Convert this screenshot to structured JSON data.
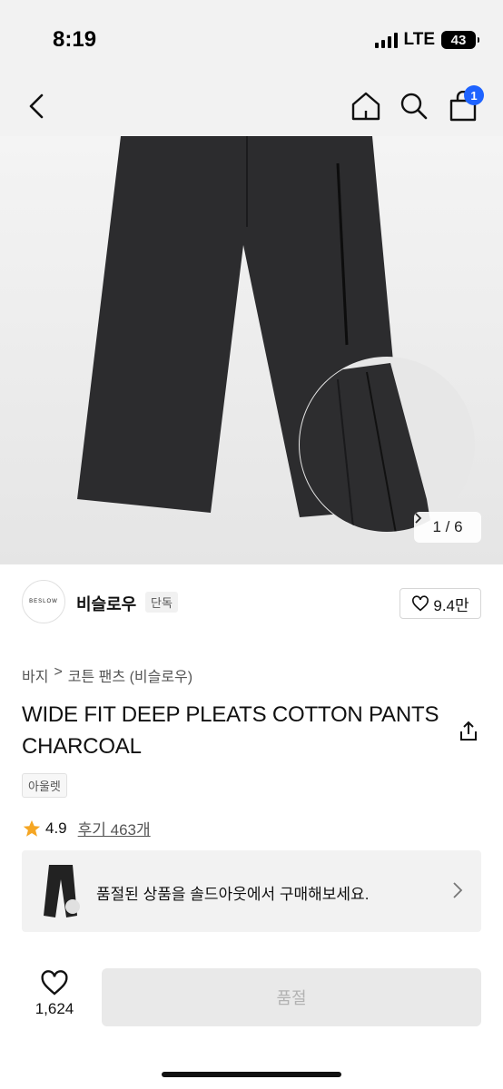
{
  "status_bar": {
    "time": "8:19",
    "network": "LTE",
    "battery": "43"
  },
  "nav": {
    "back_icon": "chevron-left-icon",
    "home_icon": "home-icon",
    "search_icon": "search-icon",
    "cart_icon": "shopping-bag-icon",
    "cart_badge": "1"
  },
  "gallery": {
    "counter": "1 / 6"
  },
  "brand": {
    "logo_text": "BESLOW",
    "name": "비슬로우",
    "tag": "단독",
    "like_count": "9.4만"
  },
  "breadcrumb": {
    "level1": "바지",
    "separator": ">",
    "level2": "코튼 팬츠 (비슬로우)"
  },
  "product": {
    "title": "WIDE FIT DEEP PLEATS COTTON PANTS CHARCOAL",
    "tag": "아울렛",
    "rating": "4.9",
    "review_label": "후기 463개"
  },
  "soldout_banner": {
    "text": "품절된 상품을 솔드아웃에서 구매해보세요."
  },
  "bottom_bar": {
    "wish_count": "1,624",
    "buy_label": "품절"
  },
  "colors": {
    "accent": "#1e63ff",
    "star": "#f5a623",
    "disabled_bg": "#e9e9e9",
    "disabled_text": "#b2b2b2"
  }
}
